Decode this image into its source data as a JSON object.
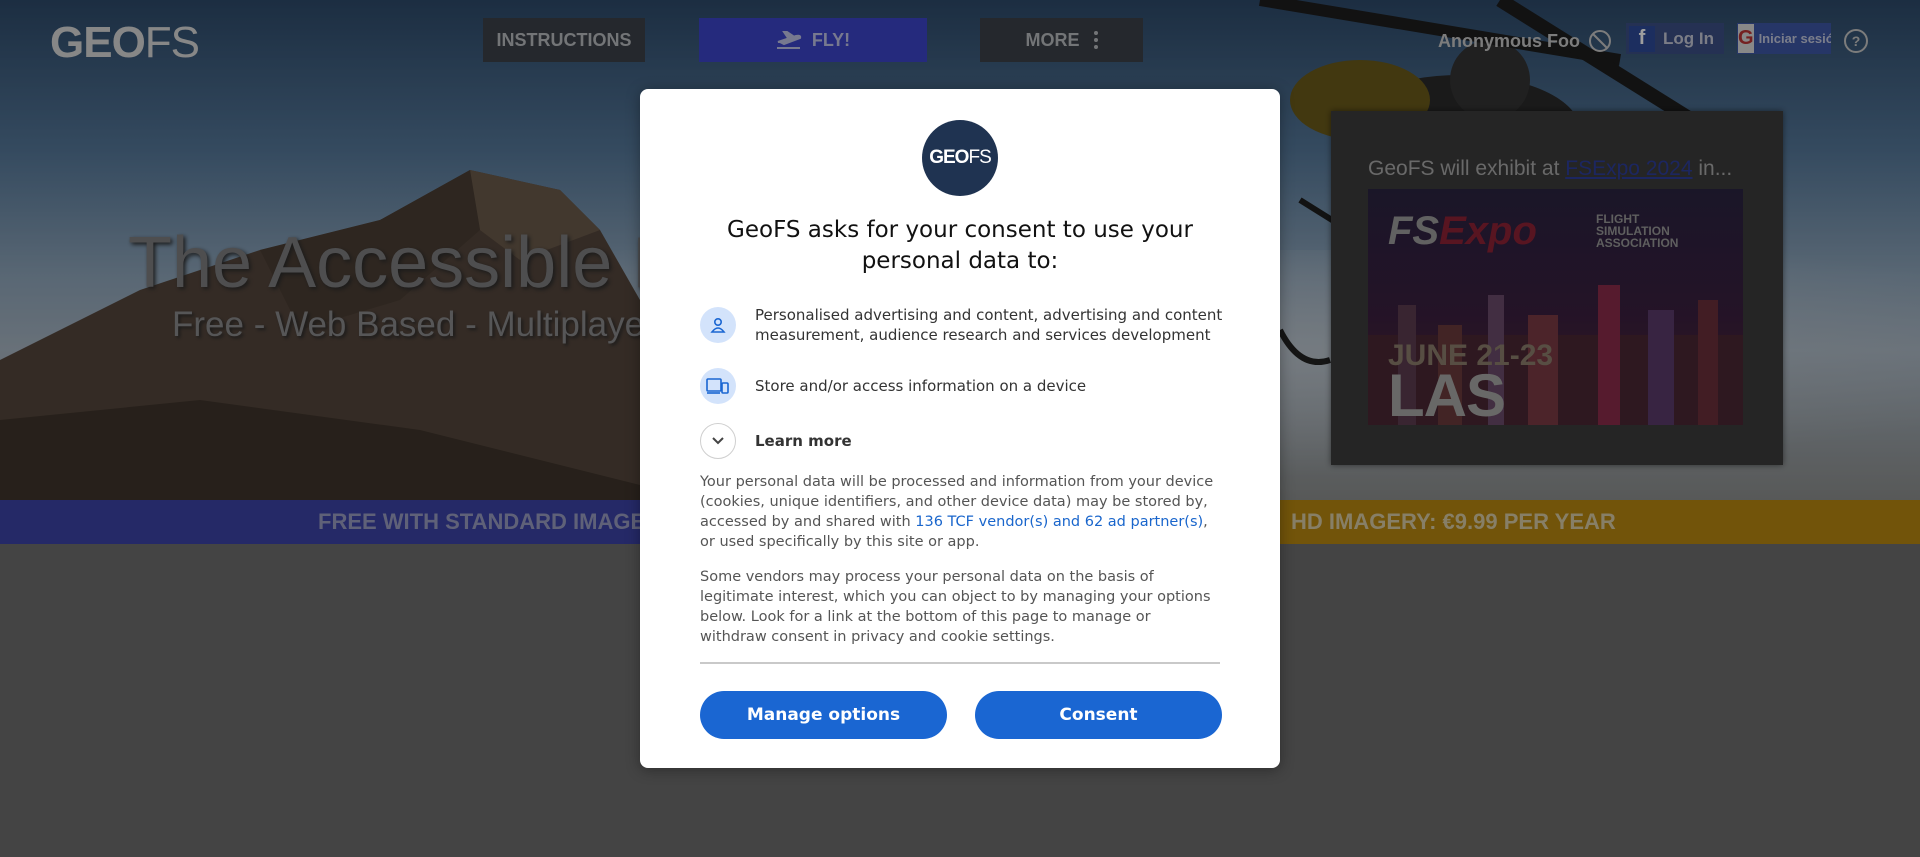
{
  "header": {
    "logo_left": "GEO",
    "logo_right": "FS",
    "nav": {
      "instructions": "INSTRUCTIONS",
      "fly": "FLY!",
      "more": "MORE"
    },
    "user_name": "Anonymous Foo",
    "facebook_label": "Log In",
    "google_label": "Iniciar sesión"
  },
  "hero": {
    "headline": "The Accessible Flight Simulator",
    "subline": "Free - Web Based - Multiplayer"
  },
  "promo": {
    "text_prefix": "GeoFS will exhibit at ",
    "link_text": "FSExpo 2024",
    "text_suffix": " in...",
    "banner_dates": "JUNE 21-23",
    "banner_city": "LAS VEGAS!",
    "banner_brand_a": "FS",
    "banner_brand_b": "Expo",
    "banner_assoc": "FLIGHT SIMULATION ASSOCIATION"
  },
  "bands": {
    "free": "FREE WITH STANDARD IMAGERY",
    "hd": "HD IMAGERY: €9.99 PER YEAR"
  },
  "consent": {
    "logo_left": "GEO",
    "logo_right": "FS",
    "title": "GeoFS asks for your consent to use your personal data to:",
    "purposes": [
      {
        "icon": "person-icon",
        "text": "Personalised advertising and content, advertising and content measurement, audience research and services development"
      },
      {
        "icon": "devices-icon",
        "text": "Store and/or access information on a device"
      }
    ],
    "learn_more": "Learn more",
    "para1_before": "Your personal data will be processed and information from your device (cookies, unique identifiers, and other device data) may be stored by, accessed by and shared with ",
    "para1_link": "136 TCF vendor(s) and 62 ad partner(s)",
    "para1_after": ", or used specifically by this site or app.",
    "para2": "Some vendors may process your personal data on the basis of legitimate interest, which you can object to by managing your options below. Look for a link at the bottom of this page to manage or withdraw consent in privacy and cookie settings.",
    "manage_button": "Manage options",
    "consent_button": "Consent",
    "accent_color": "#1a66d2"
  }
}
